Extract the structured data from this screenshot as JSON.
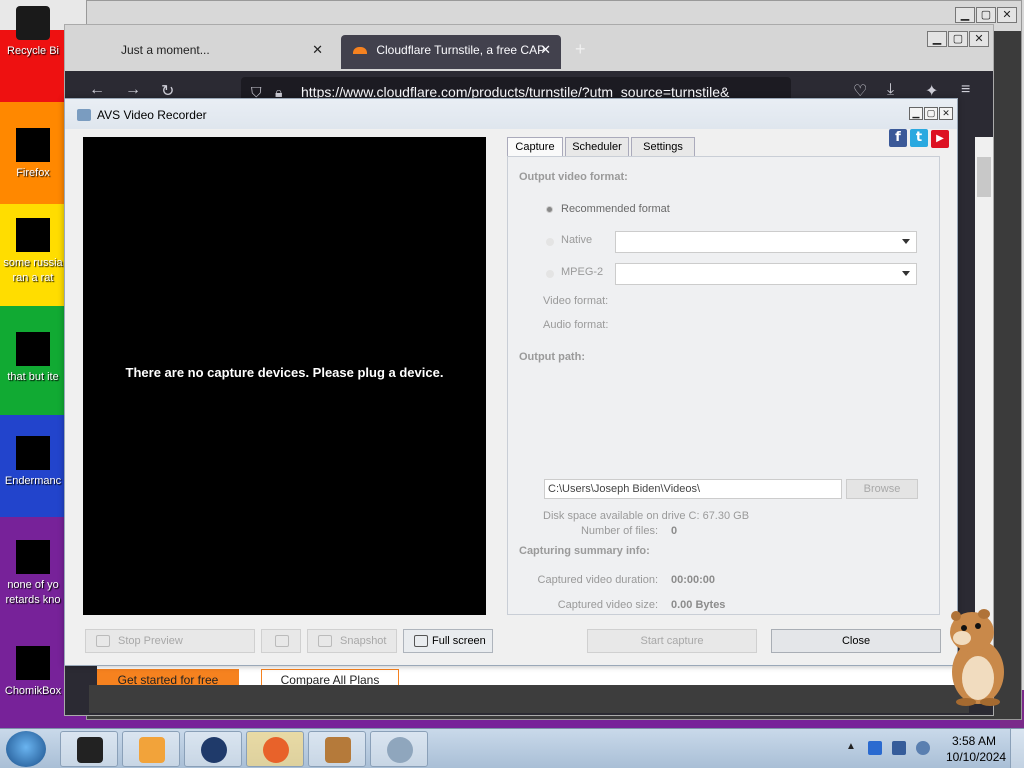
{
  "desktop": {
    "icons": [
      {
        "label": "Recycle Bi",
        "name": "recycle-bin"
      },
      {
        "label": "Firefox",
        "name": "firefox"
      },
      {
        "label": "some russia ran a rat",
        "name": "some-russia"
      },
      {
        "label": "that but ite",
        "name": "that-but"
      },
      {
        "label": "Endermanc",
        "name": "endermanch"
      },
      {
        "label": "none of yo retards kno",
        "name": "none-of-you"
      },
      {
        "label": "ChomikBox",
        "name": "chomikbox"
      }
    ]
  },
  "browser": {
    "tabs": [
      {
        "title": "Just a moment...",
        "close": "✕"
      },
      {
        "title": "Cloudflare Turnstile, a free CAP",
        "close": "✕"
      }
    ],
    "new_tab": "+",
    "url": "https://www.cloudflare.com/products/turnstile/?utm_source=turnstile&",
    "page_buttons": {
      "get_started": "Get started for free",
      "compare": "Compare All Plans"
    },
    "window_controls": {
      "minimize": "▁",
      "maximize": "▢",
      "close": "✕"
    }
  },
  "dialog": {
    "title": "AVS Video Recorder",
    "window_controls": {
      "minimize": "▁",
      "maximize": "▢",
      "close": "✕"
    },
    "social": {
      "facebook": "f",
      "twitter": "t",
      "youtube": "▶"
    },
    "preview_message": "There are no capture devices. Please plug a device.",
    "tabs": [
      "Capture",
      "Scheduler",
      "Settings"
    ],
    "active_tab": "Capture",
    "capture": {
      "output_format_heading": "Output video format:",
      "recommended_label": "Recommended format",
      "native_label": "Native",
      "native_value": "",
      "mpeg2_label": "MPEG-2",
      "mpeg2_value": "",
      "video_format_label": "Video format:",
      "audio_format_label": "Audio format:",
      "output_path_heading": "Output path:",
      "output_path_value": "C:\\Users\\Joseph Biden\\Videos\\",
      "browse_label": "Browse",
      "disk_space": "Disk space available on drive C: 67.30 GB",
      "summary_heading": "Capturing summary info:",
      "duration_label": "Captured video duration:",
      "duration_value": "00:00:00",
      "size_label": "Captured video size:",
      "size_value": "0.00 Bytes",
      "files_label": "Number of files:",
      "files_value": "0"
    },
    "buttons": {
      "stop_preview": "Stop Preview",
      "snapshot": "Snapshot",
      "full_screen": "Full screen",
      "start_capture": "Start capture",
      "close": "Close"
    }
  },
  "taskbar": {
    "time": "3:58 AM",
    "date": "10/10/2024",
    "tray_arrow": "▲"
  }
}
